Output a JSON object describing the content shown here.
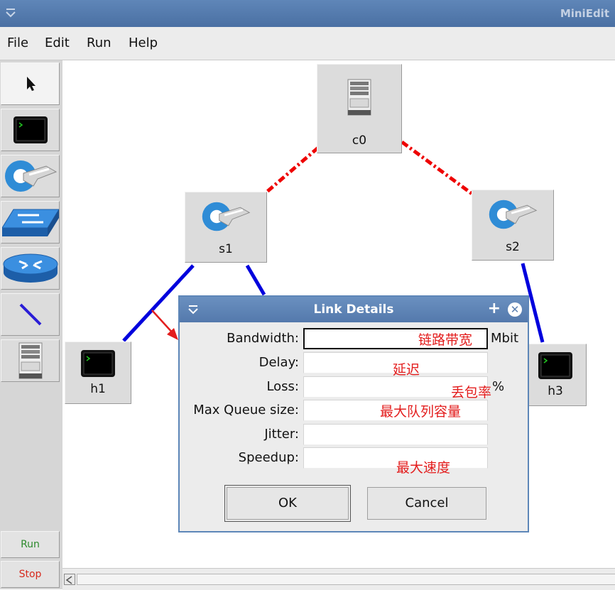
{
  "window": {
    "app_title": "MiniEdit"
  },
  "menu": {
    "items": [
      "File",
      "Edit",
      "Run",
      "Help"
    ]
  },
  "toolbar": {
    "tools": [
      "select-arrow-icon",
      "host-terminal-icon",
      "controller-switch-icon",
      "legacy-switch-icon",
      "router-icon",
      "link-line-icon",
      "server-controller-icon"
    ],
    "run_label": "Run",
    "stop_label": "Stop"
  },
  "topology": {
    "nodes": {
      "c0": "c0",
      "s1": "s1",
      "s2": "s2",
      "h1": "h1",
      "h3": "h3"
    },
    "colors": {
      "control_link": "#ee0000",
      "data_link": "#0000dd"
    }
  },
  "dialog": {
    "title": "Link Details",
    "fields": [
      {
        "label": "Bandwidth:",
        "value": "",
        "unit": "Mbit",
        "annotation": "链路带宽"
      },
      {
        "label": "Delay:",
        "value": "",
        "unit": "",
        "annotation": "延迟"
      },
      {
        "label": "Loss:",
        "value": "",
        "unit": "%",
        "annotation": "丢包率"
      },
      {
        "label": "Max Queue size:",
        "value": "",
        "unit": "",
        "annotation": "最大队列容量"
      },
      {
        "label": "Jitter:",
        "value": "",
        "unit": "",
        "annotation": ""
      },
      {
        "label": "Speedup:",
        "value": "",
        "unit": "",
        "annotation": "最大速度"
      }
    ],
    "ok_label": "OK",
    "cancel_label": "Cancel"
  },
  "annotation_color": "#e31d1d"
}
